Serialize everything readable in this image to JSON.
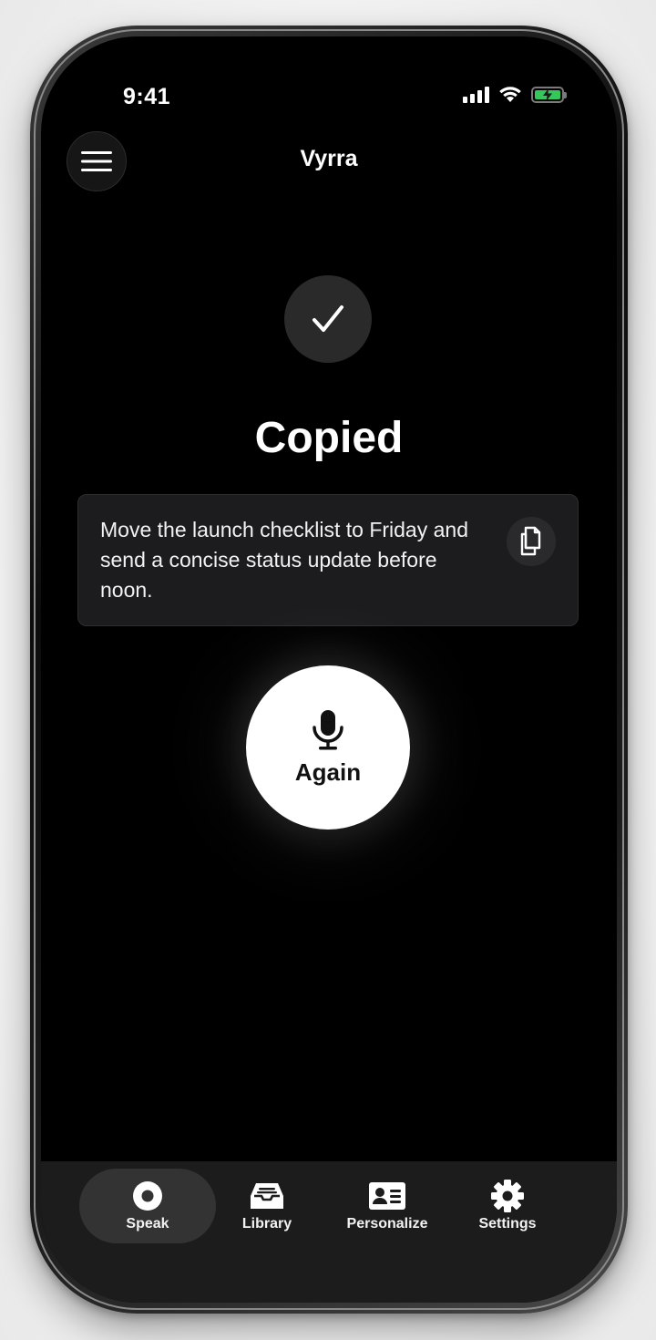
{
  "status_bar": {
    "time": "9:41"
  },
  "header": {
    "title": "Vyrra"
  },
  "result": {
    "status_title": "Copied",
    "transcript": "Move the launch checklist to Friday and send a concise status update before noon."
  },
  "record": {
    "label": "Again"
  },
  "tab_bar": {
    "items": [
      {
        "label": "Speak",
        "icon": "record-circle-icon",
        "active": true
      },
      {
        "label": "Library",
        "icon": "inbox-tray-icon",
        "active": false
      },
      {
        "label": "Personalize",
        "icon": "id-card-icon",
        "active": false
      },
      {
        "label": "Settings",
        "icon": "gear-icon",
        "active": false
      }
    ]
  },
  "colors": {
    "background": "#000000",
    "card": "#1c1c1e",
    "tab_bar": "#1c1c1c",
    "tab_active": "#333334",
    "battery": "#34c759",
    "accent": "#ffffff"
  }
}
